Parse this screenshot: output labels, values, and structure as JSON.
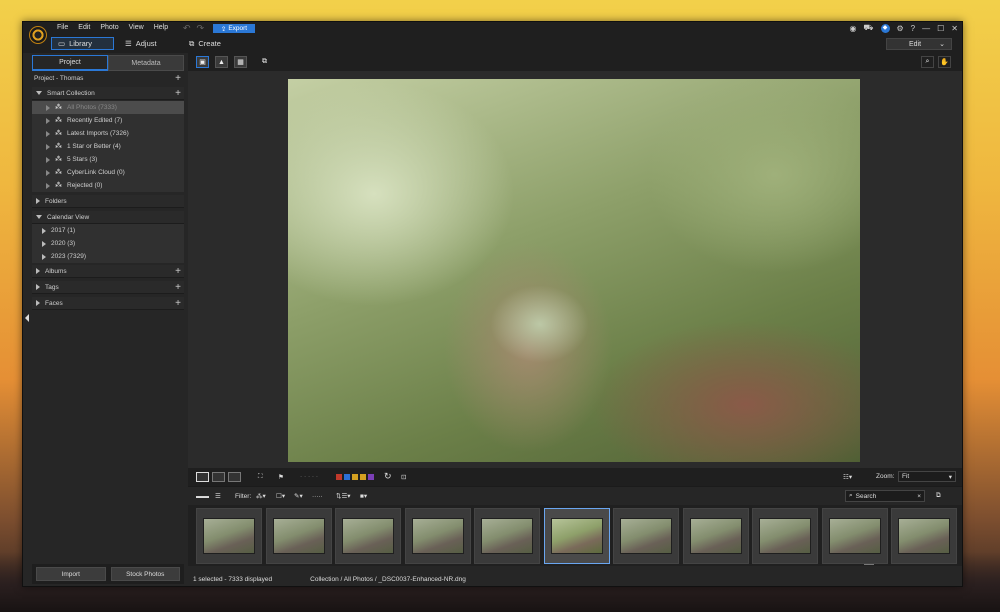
{
  "menu": [
    "File",
    "Edit",
    "Photo",
    "View",
    "Help"
  ],
  "export_label": "Export",
  "modes": {
    "library": "Library",
    "adjust": "Adjust",
    "create": "Create"
  },
  "edit_dropdown": "Edit",
  "sidebar": {
    "tabs": [
      "Project",
      "Metadata"
    ],
    "project_title": "Project - Thomas",
    "smart_collection": "Smart Collection",
    "smart_items": [
      "All Photos (7333)",
      "Recently Edited (7)",
      "Latest Imports (7326)",
      "1 Star or Better (4)",
      "5 Stars (3)",
      "CyberLink Cloud (0)",
      "Rejected (0)"
    ],
    "folders": "Folders",
    "calendar": "Calendar View",
    "calendar_items": [
      "2017 (1)",
      "2020 (3)",
      "2023 (7329)"
    ],
    "albums": "Albums",
    "tags": "Tags",
    "faces": "Faces",
    "import_btn": "Import",
    "stock_btn": "Stock Photos"
  },
  "zoom": {
    "label": "Zoom:",
    "value": "Fit"
  },
  "filter_label": "Filter:",
  "search_placeholder": "Search",
  "color_labels": [
    "#c0392b",
    "#2b6fd6",
    "#d4a020",
    "#d4a020",
    "#7b3fb6"
  ],
  "status": {
    "selected": "1 selected - 7333 displayed",
    "path": "Collection / All Photos / _DSC0037-Enhanced-NR.dng"
  },
  "thumbnail_count": 11,
  "selected_thumbnail_index": 5
}
